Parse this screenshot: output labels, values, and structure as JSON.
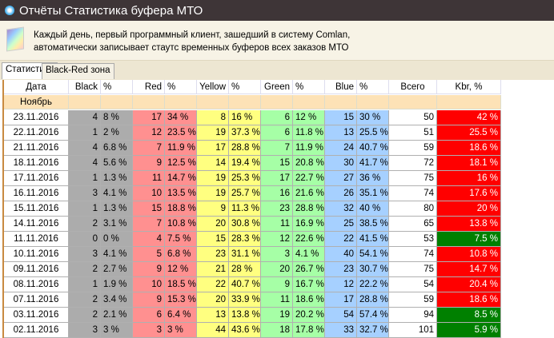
{
  "window": {
    "title": "Отчёты Статистика буфера МТО"
  },
  "info": {
    "line1": "Каждый день, первый программный клиент, зашедший в систему Comlan,",
    "line2": "автоматически записывает стаутс временных буферов всех заказов МТО"
  },
  "tabs": [
    {
      "label": "Статистика",
      "active": true
    },
    {
      "label": "Black-Red зона",
      "active": false
    }
  ],
  "columns": {
    "date": "Дата",
    "black": "Black",
    "red": "Red",
    "yellow": "Yellow",
    "green": "Green",
    "blue": "Blue",
    "pct": "%",
    "total": "Всего",
    "kbr": "Kbr, %"
  },
  "group": "Ноябрь",
  "colors": {
    "black": "#acacac",
    "red": "#ff9090",
    "yellow": "#ffff80",
    "green": "#a6ffa6",
    "blue": "#a6d0ff",
    "kbr_bad": "#ff0000",
    "kbr_good": "#008000"
  },
  "rows": [
    [
      "23.11.2016",
      "4",
      "8 %",
      "17",
      "34 %",
      "8",
      "16 %",
      "6",
      "12 %",
      "15",
      "30 %",
      "50",
      "42 %",
      "bad"
    ],
    [
      "22.11.2016",
      "1",
      "2 %",
      "12",
      "23.5 %",
      "19",
      "37.3 %",
      "6",
      "11.8 %",
      "13",
      "25.5 %",
      "51",
      "25.5 %",
      "bad"
    ],
    [
      "21.11.2016",
      "4",
      "6.8 %",
      "7",
      "11.9 %",
      "17",
      "28.8 %",
      "7",
      "11.9 %",
      "24",
      "40.7 %",
      "59",
      "18.6 %",
      "bad"
    ],
    [
      "18.11.2016",
      "4",
      "5.6 %",
      "9",
      "12.5 %",
      "14",
      "19.4 %",
      "15",
      "20.8 %",
      "30",
      "41.7 %",
      "72",
      "18.1 %",
      "bad"
    ],
    [
      "17.11.2016",
      "1",
      "1.3 %",
      "11",
      "14.7 %",
      "19",
      "25.3 %",
      "17",
      "22.7 %",
      "27",
      "36 %",
      "75",
      "16 %",
      "bad"
    ],
    [
      "16.11.2016",
      "3",
      "4.1 %",
      "10",
      "13.5 %",
      "19",
      "25.7 %",
      "16",
      "21.6 %",
      "26",
      "35.1 %",
      "74",
      "17.6 %",
      "bad"
    ],
    [
      "15.11.2016",
      "1",
      "1.3 %",
      "15",
      "18.8 %",
      "9",
      "11.3 %",
      "23",
      "28.8 %",
      "32",
      "40 %",
      "80",
      "20 %",
      "bad"
    ],
    [
      "14.11.2016",
      "2",
      "3.1 %",
      "7",
      "10.8 %",
      "20",
      "30.8 %",
      "11",
      "16.9 %",
      "25",
      "38.5 %",
      "65",
      "13.8 %",
      "bad"
    ],
    [
      "11.11.2016",
      "0",
      "0 %",
      "4",
      "7.5 %",
      "15",
      "28.3 %",
      "12",
      "22.6 %",
      "22",
      "41.5 %",
      "53",
      "7.5 %",
      "good"
    ],
    [
      "10.11.2016",
      "3",
      "4.1 %",
      "5",
      "6.8 %",
      "23",
      "31.1 %",
      "3",
      "4.1 %",
      "40",
      "54.1 %",
      "74",
      "10.8 %",
      "bad"
    ],
    [
      "09.11.2016",
      "2",
      "2.7 %",
      "9",
      "12 %",
      "21",
      "28 %",
      "20",
      "26.7 %",
      "23",
      "30.7 %",
      "75",
      "14.7 %",
      "bad"
    ],
    [
      "08.11.2016",
      "1",
      "1.9 %",
      "10",
      "18.5 %",
      "22",
      "40.7 %",
      "9",
      "16.7 %",
      "12",
      "22.2 %",
      "54",
      "20.4 %",
      "bad"
    ],
    [
      "07.11.2016",
      "2",
      "3.4 %",
      "9",
      "15.3 %",
      "20",
      "33.9 %",
      "11",
      "18.6 %",
      "17",
      "28.8 %",
      "59",
      "18.6 %",
      "bad"
    ],
    [
      "03.11.2016",
      "2",
      "2.1 %",
      "6",
      "6.4 %",
      "13",
      "13.8 %",
      "19",
      "20.2 %",
      "54",
      "57.4 %",
      "94",
      "8.5 %",
      "good"
    ],
    [
      "02.11.2016",
      "3",
      "3 %",
      "3",
      "3 %",
      "44",
      "43.6 %",
      "18",
      "17.8 %",
      "33",
      "32.7 %",
      "101",
      "5.9 %",
      "good"
    ]
  ]
}
